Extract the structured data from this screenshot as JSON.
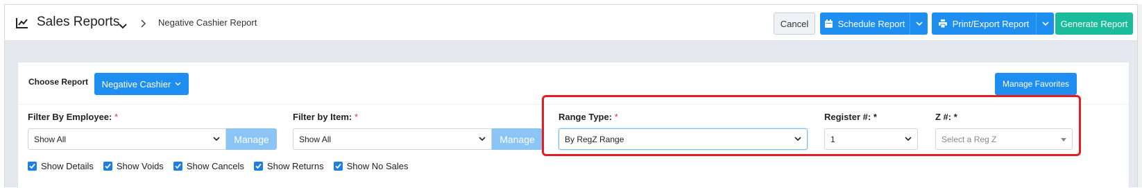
{
  "header": {
    "title": "Sales Reports",
    "breadcrumb": "Negative Cashier Report",
    "buttons": {
      "cancel": "Cancel",
      "schedule": "Schedule Report",
      "print_export": "Print/Export Report",
      "generate": "Generate Report"
    }
  },
  "report_selector": {
    "label": "Choose Report",
    "selected": "Negative Cashier",
    "favorites_button": "Manage Favorites"
  },
  "filters": {
    "employee": {
      "label": "Filter By Employee:",
      "required_mark": "*",
      "value": "Show All",
      "manage_label": "Manage"
    },
    "item": {
      "label": "Filter by Item:",
      "required_mark": "*",
      "value": "Show All",
      "manage_label": "Manage"
    },
    "range_type": {
      "label": "Range Type:",
      "required_mark": "*",
      "value": "By RegZ Range"
    },
    "register": {
      "label": "Register #:",
      "required_mark": "*",
      "value": "1"
    },
    "z_number": {
      "label": "Z #:",
      "required_mark": "*",
      "placeholder": "Select a Reg Z"
    }
  },
  "options": [
    {
      "label": "Show Details",
      "checked": true
    },
    {
      "label": "Show Voids",
      "checked": true
    },
    {
      "label": "Show Cancels",
      "checked": true
    },
    {
      "label": "Show Returns",
      "checked": true
    },
    {
      "label": "Show No Sales",
      "checked": true
    }
  ],
  "colors": {
    "primary": "#1e8ff0",
    "generate": "#1bbc9b",
    "manage": "#8ac5f6",
    "highlight": "#e41c23"
  }
}
